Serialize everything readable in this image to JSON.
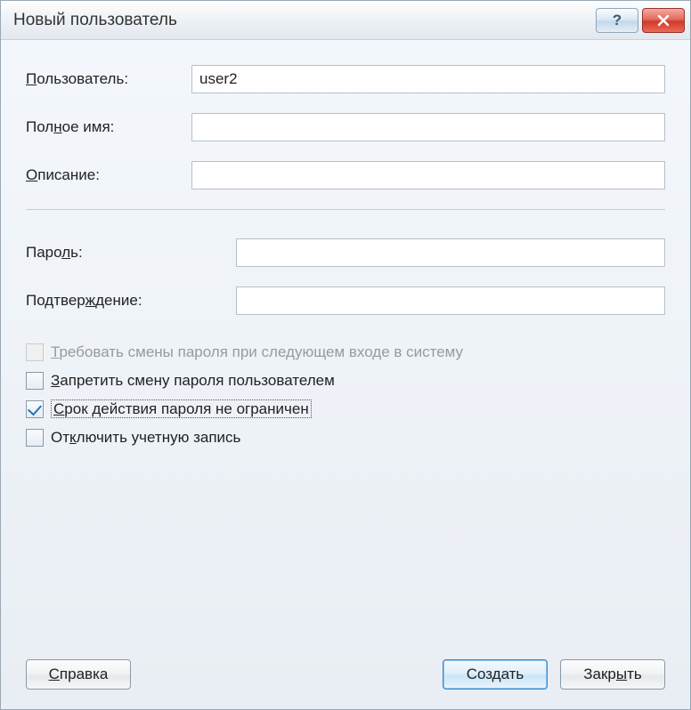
{
  "window": {
    "title": "Новый пользователь"
  },
  "fields": {
    "user_label_pre": "",
    "user_label_u": "П",
    "user_label_post": "ользователь:",
    "user_value": "user2",
    "fullname_label_pre": "Пол",
    "fullname_label_u": "н",
    "fullname_label_post": "ое имя:",
    "fullname_value": "",
    "desc_label_pre": "",
    "desc_label_u": "О",
    "desc_label_post": "писание:",
    "desc_value": "",
    "pass_label_pre": "Паро",
    "pass_label_u": "л",
    "pass_label_post": "ь:",
    "pass_value": "",
    "confirm_label_pre": "Подтвер",
    "confirm_label_u": "ж",
    "confirm_label_post": "дение:",
    "confirm_value": ""
  },
  "checks": {
    "require_change_pre": "",
    "require_change_u": "Т",
    "require_change_post": "ребовать смены пароля при следующем входе в систему",
    "deny_change_pre": "",
    "deny_change_u": "З",
    "deny_change_post": "апретить смену пароля пользователем",
    "no_expire_pre": "",
    "no_expire_u": "С",
    "no_expire_post": "рок действия пароля не ограничен",
    "disable_account_pre": "От",
    "disable_account_u": "к",
    "disable_account_post": "лючить учетную запись"
  },
  "buttons": {
    "help_pre": "",
    "help_u": "С",
    "help_post": "правка",
    "create": "Создать",
    "close_pre": "Закр",
    "close_u": "ы",
    "close_post": "ть",
    "titlebar_help": "?"
  }
}
